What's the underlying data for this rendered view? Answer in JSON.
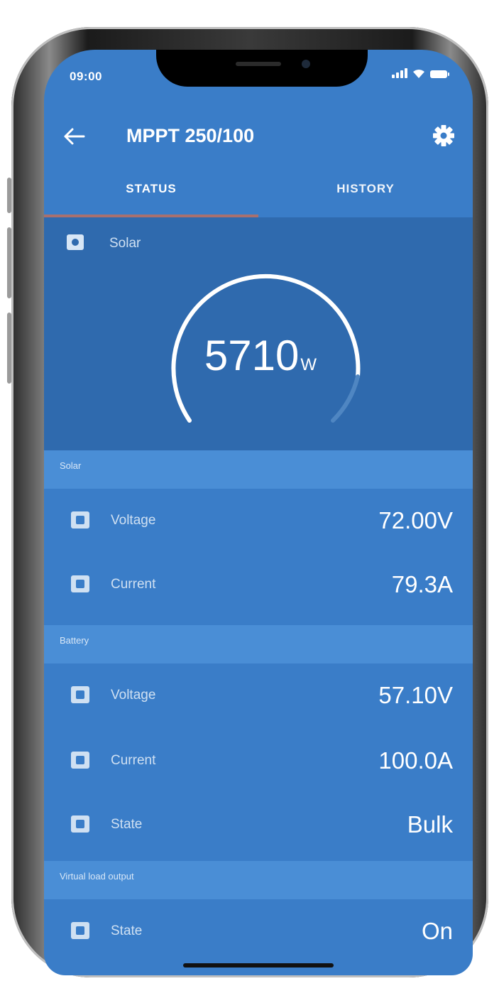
{
  "statusbar": {
    "time": "09:00"
  },
  "appbar": {
    "title": "MPPT 250/100"
  },
  "tabs": [
    {
      "label": "STATUS",
      "active": true
    },
    {
      "label": "HISTORY",
      "active": false
    }
  ],
  "hero": {
    "label": "Solar",
    "value": "5710",
    "unit": "W"
  },
  "sections": [
    {
      "title": "Solar",
      "rows": [
        {
          "label": "Voltage",
          "value": "72.00V"
        },
        {
          "label": "Current",
          "value": "79.3A"
        }
      ]
    },
    {
      "title": "Battery",
      "rows": [
        {
          "label": "Voltage",
          "value": "57.10V"
        },
        {
          "label": "Current",
          "value": "100.0A"
        },
        {
          "label": "State",
          "value": "Bulk"
        }
      ]
    },
    {
      "title": "Virtual load output",
      "rows": [
        {
          "label": "State",
          "value": "On"
        }
      ]
    }
  ],
  "colors": {
    "background": "#3a7dc8",
    "hero": "#2f6aae",
    "section_header": "#4a8ed6",
    "tab_indicator": "#a8706e"
  }
}
